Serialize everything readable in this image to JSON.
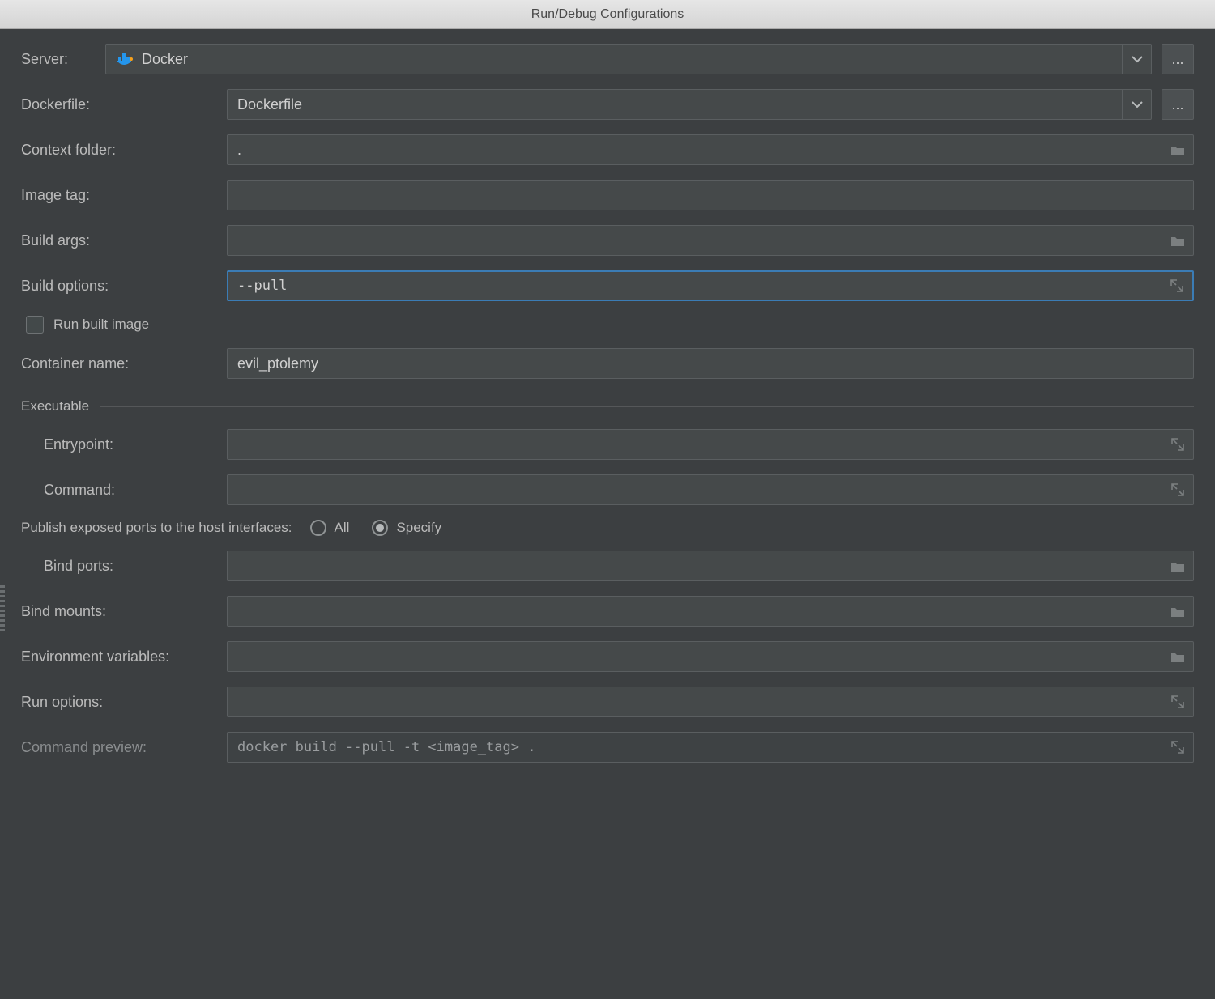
{
  "window": {
    "title": "Run/Debug Configurations"
  },
  "server": {
    "label": "Server:",
    "value": "Docker",
    "ellipsis": "..."
  },
  "fields": {
    "dockerfile": {
      "label": "Dockerfile:",
      "value": "Dockerfile"
    },
    "context_folder": {
      "label": "Context folder:",
      "value": "."
    },
    "image_tag": {
      "label": "Image tag:",
      "value": ""
    },
    "build_args": {
      "label": "Build args:",
      "value": ""
    },
    "build_options": {
      "label": "Build options:",
      "value": "--pull"
    },
    "run_built_image": {
      "label": "Run built image",
      "checked": false
    },
    "container_name": {
      "label": "Container name:",
      "value": "evil_ptolemy"
    },
    "executable_section": "Executable",
    "entrypoint": {
      "label": "Entrypoint:",
      "value": ""
    },
    "command": {
      "label": "Command:",
      "value": ""
    },
    "publish_ports": {
      "label": "Publish exposed ports to the host interfaces:",
      "options": {
        "all": "All",
        "specify": "Specify"
      },
      "selected": "specify"
    },
    "bind_ports": {
      "label": "Bind ports:",
      "value": ""
    },
    "bind_mounts": {
      "label": "Bind mounts:",
      "value": ""
    },
    "env_vars": {
      "label": "Environment variables:",
      "value": ""
    },
    "run_options": {
      "label": "Run options:",
      "value": ""
    },
    "command_preview": {
      "label": "Command preview:",
      "value": "docker build --pull -t <image_tag> ."
    }
  },
  "icons": {
    "chevron_down": "chevron-down-icon",
    "folder": "folder-icon",
    "expand": "expand-icon",
    "docker": "docker-icon"
  },
  "colors": {
    "bg": "#3c3f41",
    "field_bg": "#45494a",
    "border": "#5a5e60",
    "focus": "#3B7CB5",
    "text": "#bbbbbb"
  }
}
